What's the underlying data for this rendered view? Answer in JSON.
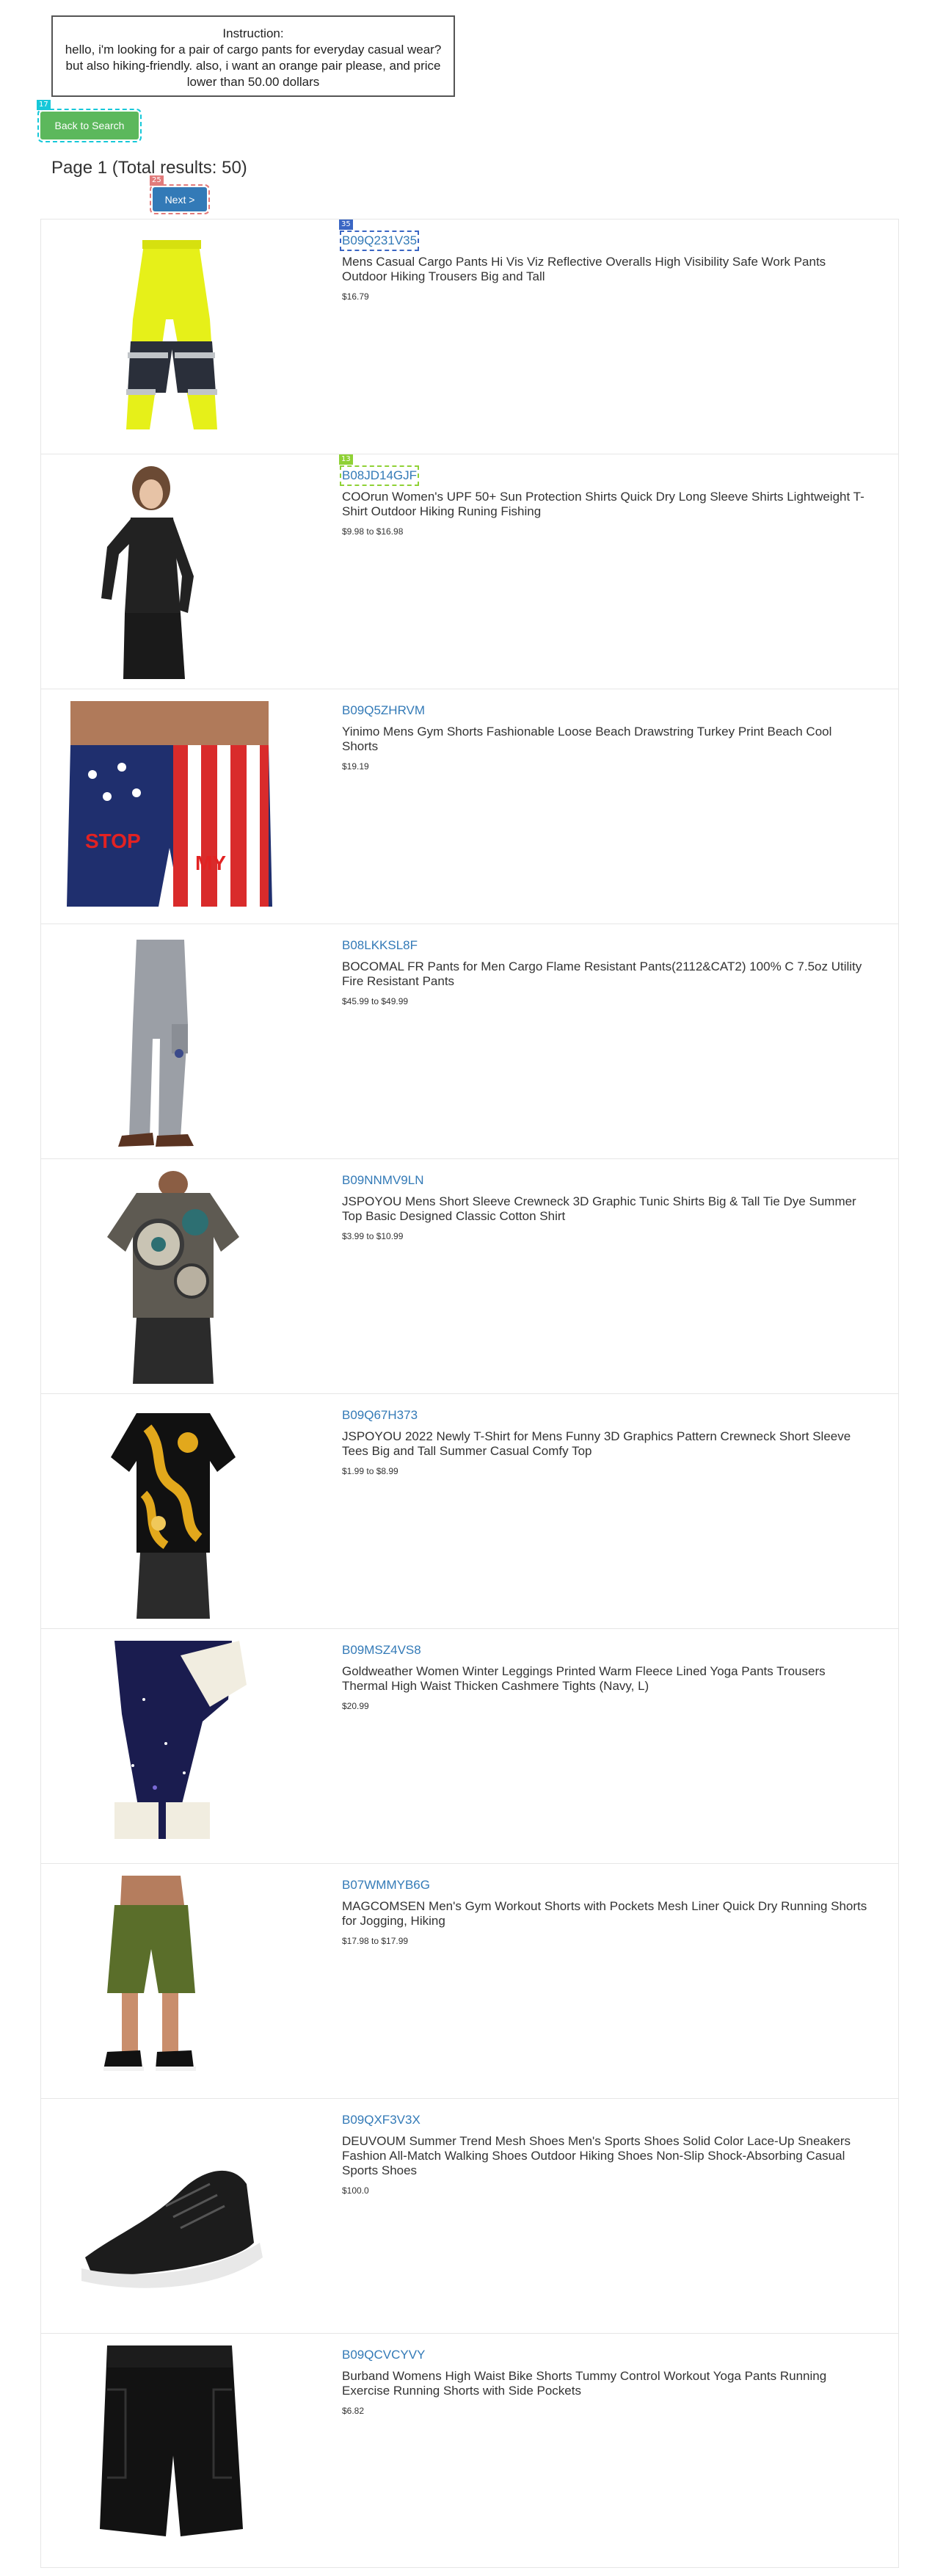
{
  "instruction": {
    "heading": "Instruction:",
    "text": "hello, i'm looking for a pair of cargo pants for everyday casual wear? but also hiking-friendly. also, i want an orange pair please, and price lower than 50.00 dollars"
  },
  "markers": {
    "back": "17",
    "next": "25",
    "first_asin": "35",
    "second_asin": "13"
  },
  "back_button": "Back to Search",
  "page_info": "Page 1 (Total results: 50)",
  "next_button": "Next >",
  "products": [
    {
      "asin": "B09Q231V35",
      "title": "Mens Casual Cargo Pants Hi Vis Viz Reflective Overalls High Visibility Safe Work Pants Outdoor Hiking Trousers Big and Tall",
      "price": "$16.79",
      "icon": "hi-vis-pants-image"
    },
    {
      "asin": "B08JD14GJF",
      "title": "COOrun Women's UPF 50+ Sun Protection Shirts Quick Dry Long Sleeve Shirts Lightweight T-Shirt Outdoor Hiking Runing Fishing",
      "price": "$9.98 to $16.98",
      "icon": "long-sleeve-shirt-image"
    },
    {
      "asin": "B09Q5ZHRVM",
      "title": "Yinimo Mens Gym Shorts Fashionable Loose Beach Drawstring Turkey Print Beach Cool Shorts",
      "price": "$19.19",
      "icon": "flag-shorts-image"
    },
    {
      "asin": "B08LKKSL8F",
      "title": "BOCOMAL FR Pants for Men Cargo Flame Resistant Pants(2112&CAT2) 100% C 7.5oz Utility Fire Resistant Pants",
      "price": "$45.99 to $49.99",
      "icon": "grey-cargo-pants-image"
    },
    {
      "asin": "B09NNMV9LN",
      "title": "JSPOYOU Mens Short Sleeve Crewneck 3D Graphic Tunic Shirts Big & Tall Tie Dye Summer Top Basic Designed Classic Cotton Shirt",
      "price": "$3.99 to $10.99",
      "icon": "gear-print-shirt-image"
    },
    {
      "asin": "B09Q67H373",
      "title": "JSPOYOU 2022 Newly T-Shirt for Mens Funny 3D Graphics Pattern Crewneck Short Sleeve Tees Big and Tall Summer Casual Comfy Top",
      "price": "$1.99 to $8.99",
      "icon": "baroque-shirt-image"
    },
    {
      "asin": "B09MSZ4VS8",
      "title": "Goldweather Women Winter Leggings Printed Warm Fleece Lined Yoga Pants Trousers Thermal High Waist Thicken Cashmere Tights (Navy, L)",
      "price": "$20.99",
      "icon": "galaxy-leggings-image"
    },
    {
      "asin": "B07WMMYB6G",
      "title": "MAGCOMSEN Men's Gym Workout Shorts with Pockets Mesh Liner Quick Dry Running Shorts for Jogging, Hiking",
      "price": "$17.98 to $17.99",
      "icon": "olive-shorts-image"
    },
    {
      "asin": "B09QXF3V3X",
      "title": "DEUVOUM Summer Trend Mesh Shoes Men's Sports Shoes Solid Color Lace-Up Sneakers Fashion All-Match Walking Shoes Outdoor Hiking Shoes Non-Slip Shock-Absorbing Casual Sports Shoes",
      "price": "$100.0",
      "icon": "sneaker-image"
    },
    {
      "asin": "B09QCVCYVY",
      "title": "Burband Womens High Waist Bike Shorts Tummy Control Workout Yoga Pants Running Exercise Running Shorts with Side Pockets",
      "price": "$6.82",
      "icon": "bike-shorts-image"
    }
  ]
}
